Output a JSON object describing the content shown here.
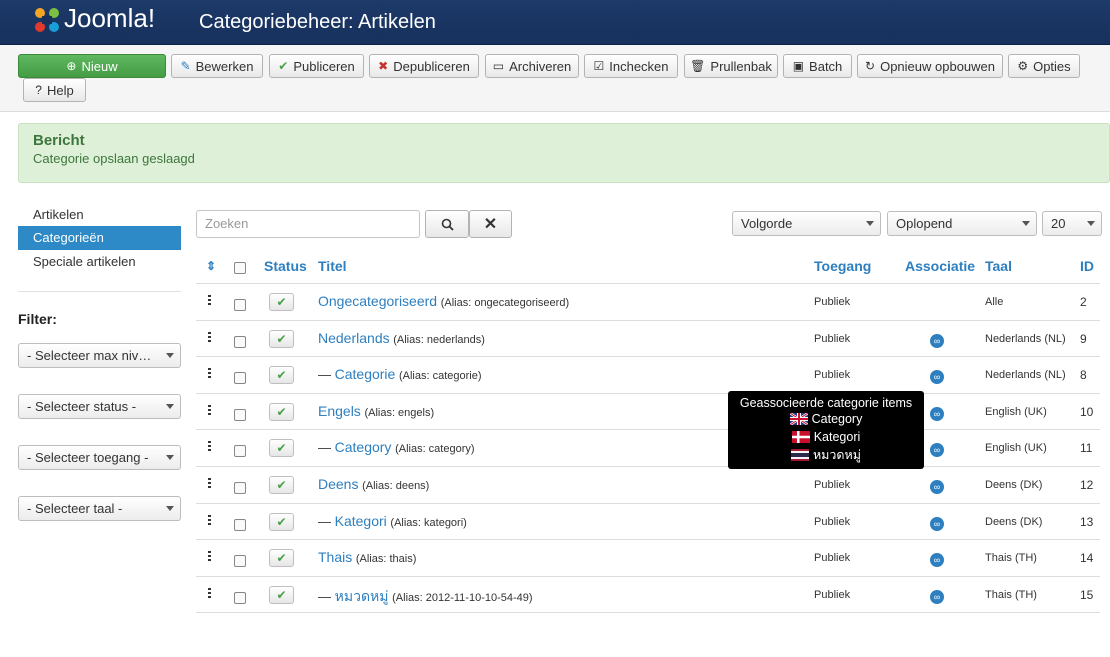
{
  "header": {
    "logo_text": "Joomla!",
    "title": "Categoriebeheer: Artikelen"
  },
  "toolbar": {
    "new": "Nieuw",
    "edit": "Bewerken",
    "publish": "Publiceren",
    "unpublish": "Depubliceren",
    "archive": "Archiveren",
    "checkin": "Inchecken",
    "trash": "Prullenbak",
    "batch": "Batch",
    "rebuild": "Opnieuw opbouwen",
    "options": "Opties",
    "help": "Help"
  },
  "message": {
    "title": "Bericht",
    "text": "Categorie opslaan geslaagd"
  },
  "sidebar": {
    "items": [
      "Artikelen",
      "Categorieën",
      "Speciale artikelen"
    ],
    "filter_label": "Filter:",
    "filters": [
      "- Selecteer max niv…",
      "- Selecteer status -",
      "- Selecteer toegang -",
      "- Selecteer taal -"
    ]
  },
  "search": {
    "placeholder": "Zoeken"
  },
  "sort": {
    "field": "Volgorde",
    "direction": "Oplopend",
    "limit": "20"
  },
  "table": {
    "headers": {
      "status": "Status",
      "title": "Titel",
      "access": "Toegang",
      "association": "Associatie",
      "language": "Taal",
      "id": "ID"
    },
    "rows": [
      {
        "dash": "",
        "title": "Ongecategoriseerd",
        "alias": "(Alias: ongecategoriseerd)",
        "access": "Publiek",
        "assoc": false,
        "lang": "Alle",
        "id": "2"
      },
      {
        "dash": "",
        "title": "Nederlands",
        "alias": "(Alias: nederlands)",
        "access": "Publiek",
        "assoc": true,
        "lang": "Nederlands (NL)",
        "id": "9"
      },
      {
        "dash": "— ",
        "title": "Categorie",
        "alias": "(Alias: categorie)",
        "access": "Publiek",
        "assoc": true,
        "lang": "Nederlands (NL)",
        "id": "8"
      },
      {
        "dash": "",
        "title": "Engels",
        "alias": "(Alias: engels)",
        "access": "",
        "assoc": true,
        "lang": "English (UK)",
        "id": "10"
      },
      {
        "dash": "— ",
        "title": "Category",
        "alias": "(Alias: category)",
        "access": "",
        "assoc": true,
        "lang": "English (UK)",
        "id": "11"
      },
      {
        "dash": "",
        "title": "Deens",
        "alias": "(Alias: deens)",
        "access": "Publiek",
        "assoc": true,
        "lang": "Deens (DK)",
        "id": "12"
      },
      {
        "dash": "— ",
        "title": "Kategori",
        "alias": "(Alias: kategori)",
        "access": "Publiek",
        "assoc": true,
        "lang": "Deens (DK)",
        "id": "13"
      },
      {
        "dash": "",
        "title": "Thais",
        "alias": "(Alias: thais)",
        "access": "Publiek",
        "assoc": true,
        "lang": "Thais (TH)",
        "id": "14"
      },
      {
        "dash": "— ",
        "title": "หมวดหมู่",
        "alias": "(Alias: 2012-11-10-10-54-49)",
        "access": "Publiek",
        "assoc": true,
        "lang": "Thais (TH)",
        "id": "15"
      }
    ]
  },
  "tooltip": {
    "title": "Geassocieerde categorie items",
    "items": [
      "Category",
      "Kategori",
      "หมวดหมู่"
    ]
  },
  "colors": {
    "header_bg": "#1d3a69",
    "accent": "#2d7fbf",
    "success_bg": "#dff0d8",
    "new_button": "#4fa94f"
  }
}
